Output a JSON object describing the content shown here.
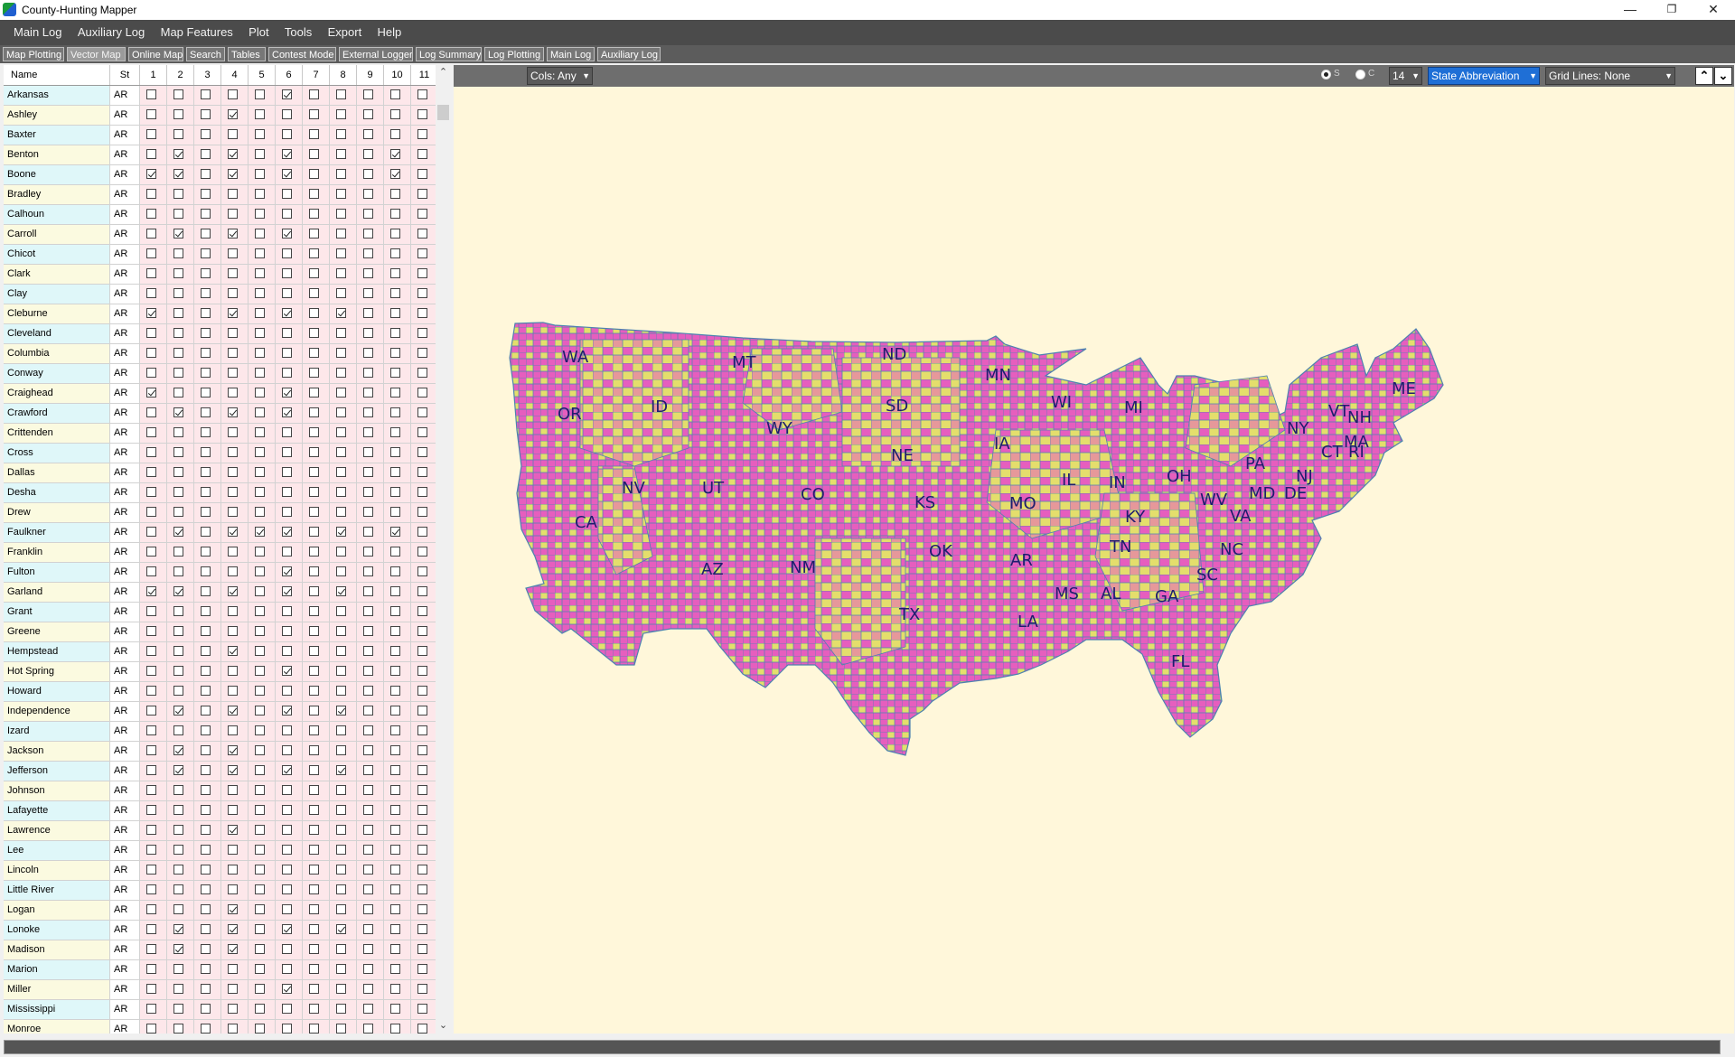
{
  "window": {
    "title": "County-Hunting Mapper",
    "minimize": "—",
    "restore": "❐",
    "close": "✕"
  },
  "menu": [
    "Main Log",
    "Auxiliary Log",
    "Map Features",
    "Plot",
    "Tools",
    "Export",
    "Help"
  ],
  "tabs": [
    {
      "label": "Map Plotting",
      "active": false
    },
    {
      "label": "Vector Map",
      "active": true
    },
    {
      "label": "Online Map",
      "active": false
    },
    {
      "label": "Search",
      "active": false
    },
    {
      "label": "Tables",
      "active": false
    },
    {
      "label": "Contest Mode",
      "active": false
    },
    {
      "label": "External Logger",
      "active": false
    },
    {
      "label": "Log Summary",
      "active": false
    },
    {
      "label": "Log Plotting",
      "active": false
    },
    {
      "label": "Main Log",
      "active": false
    },
    {
      "label": "Auxiliary Log",
      "active": false
    }
  ],
  "grid": {
    "headers": {
      "name": "Name",
      "state": "St",
      "cols": [
        "1",
        "2",
        "3",
        "4",
        "5",
        "6",
        "7",
        "8",
        "9",
        "10",
        "11"
      ]
    },
    "rows": [
      {
        "name": "Arkansas",
        "st": "AR",
        "checks": [
          0,
          0,
          0,
          0,
          0,
          1,
          0,
          0,
          0,
          0,
          0
        ]
      },
      {
        "name": "Ashley",
        "st": "AR",
        "checks": [
          0,
          0,
          0,
          1,
          0,
          0,
          0,
          0,
          0,
          0,
          0
        ]
      },
      {
        "name": "Baxter",
        "st": "AR",
        "checks": [
          0,
          0,
          0,
          0,
          0,
          0,
          0,
          0,
          0,
          0,
          0
        ]
      },
      {
        "name": "Benton",
        "st": "AR",
        "checks": [
          0,
          1,
          0,
          1,
          0,
          1,
          0,
          0,
          0,
          1,
          0
        ]
      },
      {
        "name": "Boone",
        "st": "AR",
        "checks": [
          1,
          1,
          0,
          1,
          0,
          1,
          0,
          0,
          0,
          1,
          0
        ]
      },
      {
        "name": "Bradley",
        "st": "AR",
        "checks": [
          0,
          0,
          0,
          0,
          0,
          0,
          0,
          0,
          0,
          0,
          0
        ]
      },
      {
        "name": "Calhoun",
        "st": "AR",
        "checks": [
          0,
          0,
          0,
          0,
          0,
          0,
          0,
          0,
          0,
          0,
          0
        ]
      },
      {
        "name": "Carroll",
        "st": "AR",
        "checks": [
          0,
          1,
          0,
          1,
          0,
          1,
          0,
          0,
          0,
          0,
          0
        ]
      },
      {
        "name": "Chicot",
        "st": "AR",
        "checks": [
          0,
          0,
          0,
          0,
          0,
          0,
          0,
          0,
          0,
          0,
          0
        ]
      },
      {
        "name": "Clark",
        "st": "AR",
        "checks": [
          0,
          0,
          0,
          0,
          0,
          0,
          0,
          0,
          0,
          0,
          0
        ]
      },
      {
        "name": "Clay",
        "st": "AR",
        "checks": [
          0,
          0,
          0,
          0,
          0,
          0,
          0,
          0,
          0,
          0,
          0
        ]
      },
      {
        "name": "Cleburne",
        "st": "AR",
        "checks": [
          1,
          0,
          0,
          1,
          0,
          1,
          0,
          1,
          0,
          0,
          0
        ]
      },
      {
        "name": "Cleveland",
        "st": "AR",
        "checks": [
          0,
          0,
          0,
          0,
          0,
          0,
          0,
          0,
          0,
          0,
          0
        ]
      },
      {
        "name": "Columbia",
        "st": "AR",
        "checks": [
          0,
          0,
          0,
          0,
          0,
          0,
          0,
          0,
          0,
          0,
          0
        ]
      },
      {
        "name": "Conway",
        "st": "AR",
        "checks": [
          0,
          0,
          0,
          0,
          0,
          0,
          0,
          0,
          0,
          0,
          0
        ]
      },
      {
        "name": "Craighead",
        "st": "AR",
        "checks": [
          1,
          0,
          0,
          0,
          0,
          1,
          0,
          0,
          0,
          0,
          0
        ]
      },
      {
        "name": "Crawford",
        "st": "AR",
        "checks": [
          0,
          1,
          0,
          1,
          0,
          1,
          0,
          0,
          0,
          0,
          0
        ]
      },
      {
        "name": "Crittenden",
        "st": "AR",
        "checks": [
          0,
          0,
          0,
          0,
          0,
          0,
          0,
          0,
          0,
          0,
          0
        ]
      },
      {
        "name": "Cross",
        "st": "AR",
        "checks": [
          0,
          0,
          0,
          0,
          0,
          0,
          0,
          0,
          0,
          0,
          0
        ]
      },
      {
        "name": "Dallas",
        "st": "AR",
        "checks": [
          0,
          0,
          0,
          0,
          0,
          0,
          0,
          0,
          0,
          0,
          0
        ]
      },
      {
        "name": "Desha",
        "st": "AR",
        "checks": [
          0,
          0,
          0,
          0,
          0,
          0,
          0,
          0,
          0,
          0,
          0
        ]
      },
      {
        "name": "Drew",
        "st": "AR",
        "checks": [
          0,
          0,
          0,
          0,
          0,
          0,
          0,
          0,
          0,
          0,
          0
        ]
      },
      {
        "name": "Faulkner",
        "st": "AR",
        "checks": [
          0,
          1,
          0,
          1,
          1,
          1,
          0,
          1,
          0,
          1,
          0
        ]
      },
      {
        "name": "Franklin",
        "st": "AR",
        "checks": [
          0,
          0,
          0,
          0,
          0,
          0,
          0,
          0,
          0,
          0,
          0
        ]
      },
      {
        "name": "Fulton",
        "st": "AR",
        "checks": [
          0,
          0,
          0,
          0,
          0,
          1,
          0,
          0,
          0,
          0,
          0
        ]
      },
      {
        "name": "Garland",
        "st": "AR",
        "checks": [
          1,
          1,
          0,
          1,
          0,
          1,
          0,
          1,
          0,
          0,
          0
        ]
      },
      {
        "name": "Grant",
        "st": "AR",
        "checks": [
          0,
          0,
          0,
          0,
          0,
          0,
          0,
          0,
          0,
          0,
          0
        ]
      },
      {
        "name": "Greene",
        "st": "AR",
        "checks": [
          0,
          0,
          0,
          0,
          0,
          0,
          0,
          0,
          0,
          0,
          0
        ]
      },
      {
        "name": "Hempstead",
        "st": "AR",
        "checks": [
          0,
          0,
          0,
          1,
          0,
          0,
          0,
          0,
          0,
          0,
          0
        ]
      },
      {
        "name": "Hot Spring",
        "st": "AR",
        "checks": [
          0,
          0,
          0,
          0,
          0,
          1,
          0,
          0,
          0,
          0,
          0
        ]
      },
      {
        "name": "Howard",
        "st": "AR",
        "checks": [
          0,
          0,
          0,
          0,
          0,
          0,
          0,
          0,
          0,
          0,
          0
        ]
      },
      {
        "name": "Independence",
        "st": "AR",
        "checks": [
          0,
          1,
          0,
          1,
          0,
          1,
          0,
          1,
          0,
          0,
          0
        ]
      },
      {
        "name": "Izard",
        "st": "AR",
        "checks": [
          0,
          0,
          0,
          0,
          0,
          0,
          0,
          0,
          0,
          0,
          0
        ]
      },
      {
        "name": "Jackson",
        "st": "AR",
        "checks": [
          0,
          1,
          0,
          1,
          0,
          0,
          0,
          0,
          0,
          0,
          0
        ]
      },
      {
        "name": "Jefferson",
        "st": "AR",
        "checks": [
          0,
          1,
          0,
          1,
          0,
          1,
          0,
          1,
          0,
          0,
          0
        ]
      },
      {
        "name": "Johnson",
        "st": "AR",
        "checks": [
          0,
          0,
          0,
          0,
          0,
          0,
          0,
          0,
          0,
          0,
          0
        ]
      },
      {
        "name": "Lafayette",
        "st": "AR",
        "checks": [
          0,
          0,
          0,
          0,
          0,
          0,
          0,
          0,
          0,
          0,
          0
        ]
      },
      {
        "name": "Lawrence",
        "st": "AR",
        "checks": [
          0,
          0,
          0,
          1,
          0,
          0,
          0,
          0,
          0,
          0,
          0
        ]
      },
      {
        "name": "Lee",
        "st": "AR",
        "checks": [
          0,
          0,
          0,
          0,
          0,
          0,
          0,
          0,
          0,
          0,
          0
        ]
      },
      {
        "name": "Lincoln",
        "st": "AR",
        "checks": [
          0,
          0,
          0,
          0,
          0,
          0,
          0,
          0,
          0,
          0,
          0
        ]
      },
      {
        "name": "Little River",
        "st": "AR",
        "checks": [
          0,
          0,
          0,
          0,
          0,
          0,
          0,
          0,
          0,
          0,
          0
        ]
      },
      {
        "name": "Logan",
        "st": "AR",
        "checks": [
          0,
          0,
          0,
          1,
          0,
          0,
          0,
          0,
          0,
          0,
          0
        ]
      },
      {
        "name": "Lonoke",
        "st": "AR",
        "checks": [
          0,
          1,
          0,
          1,
          0,
          1,
          0,
          1,
          0,
          0,
          0
        ]
      },
      {
        "name": "Madison",
        "st": "AR",
        "checks": [
          0,
          1,
          0,
          1,
          0,
          0,
          0,
          0,
          0,
          0,
          0
        ]
      },
      {
        "name": "Marion",
        "st": "AR",
        "checks": [
          0,
          0,
          0,
          0,
          0,
          0,
          0,
          0,
          0,
          0,
          0
        ]
      },
      {
        "name": "Miller",
        "st": "AR",
        "checks": [
          0,
          0,
          0,
          0,
          0,
          1,
          0,
          0,
          0,
          0,
          0
        ]
      },
      {
        "name": "Mississippi",
        "st": "AR",
        "checks": [
          0,
          0,
          0,
          0,
          0,
          0,
          0,
          0,
          0,
          0,
          0
        ]
      },
      {
        "name": "Monroe",
        "st": "AR",
        "checks": [
          0,
          0,
          0,
          0,
          0,
          0,
          0,
          0,
          0,
          0,
          0
        ]
      }
    ]
  },
  "map_toolbar": {
    "cols": "Cols: Any",
    "radio_s": "S",
    "radio_c": "C",
    "font_size": "14",
    "label_mode": "State Abbreviation",
    "grid_lines": "Grid Lines: None",
    "up": "⌃",
    "down": "⌄"
  },
  "map": {
    "colors": {
      "worked": "#e65ebe",
      "unworked": "#e4de6c",
      "border": "#4d82b0",
      "background": "#fff7da"
    },
    "states": [
      "WA",
      "MT",
      "ND",
      "MN",
      "OR",
      "ID",
      "SD",
      "WI",
      "MI",
      "ME",
      "VT",
      "NH",
      "WY",
      "NY",
      "MA",
      "CT",
      "RI",
      "IA",
      "NE",
      "PA",
      "NJ",
      "OH",
      "IL",
      "IN",
      "NV",
      "UT",
      "CO",
      "MO",
      "KS",
      "WV",
      "MD",
      "DE",
      "VA",
      "KY",
      "CA",
      "OK",
      "AR",
      "TN",
      "NC",
      "AZ",
      "NM",
      "SC",
      "MS",
      "AL",
      "GA",
      "TX",
      "LA",
      "FL"
    ]
  }
}
